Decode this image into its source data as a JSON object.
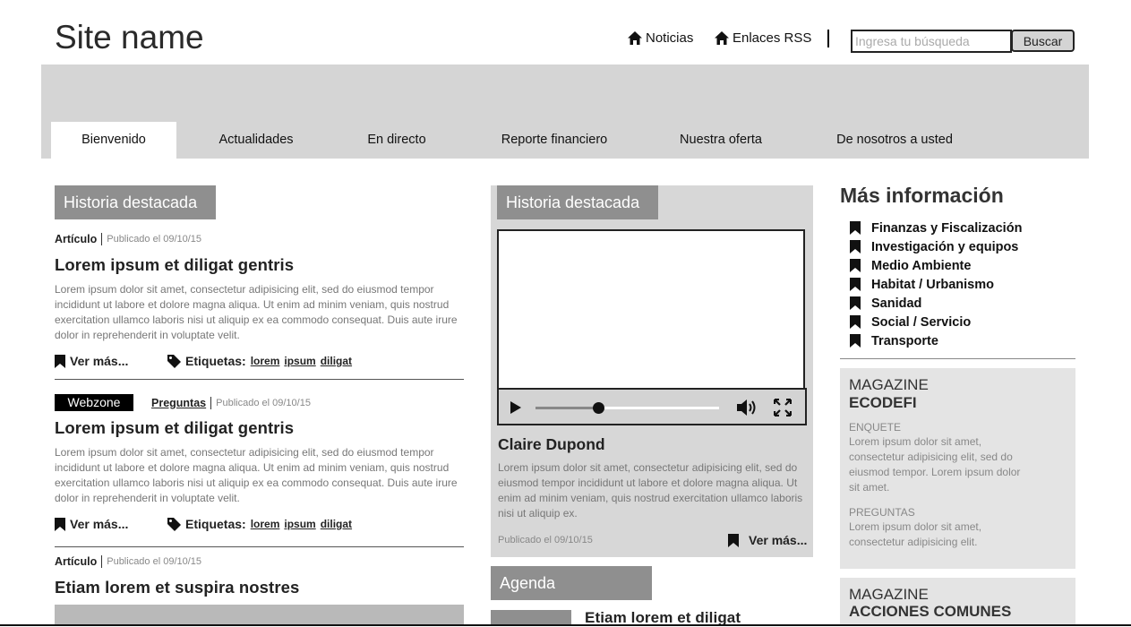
{
  "header": {
    "site_name": "Site name",
    "links": [
      {
        "label": "Noticias",
        "icon": "home-icon"
      },
      {
        "label": "Enlaces RSS",
        "icon": "home-icon"
      }
    ],
    "search": {
      "placeholder": "Ingresa tu búsqueda",
      "value": "",
      "button": "Buscar"
    }
  },
  "nav": {
    "tabs": [
      {
        "label": "Bienvenido",
        "active": true
      },
      {
        "label": "Actualidades"
      },
      {
        "label": "En directo"
      },
      {
        "label": "Reporte financiero"
      },
      {
        "label": "Nuestra oferta"
      },
      {
        "label": "De nosotros a usted"
      }
    ]
  },
  "left": {
    "section_title": "Historia destacada",
    "articles": [
      {
        "kind": "Artículo",
        "date": "Publicado el 09/10/15",
        "title": "Lorem ipsum et diligat gentris",
        "text": "Lorem ipsum dolor sit amet, consectetur adipisicing elit, sed do eiusmod tempor incididunt ut labore et dolore magna aliqua. Ut enim ad minim veniam, quis nostrud exercitation ullamco laboris nisi ut aliquip ex ea commodo consequat. Duis aute irure dolor in reprehenderit in voluptate velit.",
        "more": "Ver más...",
        "tags_label": "Etiquetas:",
        "tags": [
          "lorem",
          "ipsum",
          "diligat"
        ]
      },
      {
        "badge": "Webzone",
        "kind": "Preguntas",
        "date": "Publicado el 09/10/15",
        "title": "Lorem ipsum et diligat gentris",
        "text": "Lorem ipsum dolor sit amet, consectetur adipisicing elit, sed do eiusmod tempor incididunt ut labore et dolore magna aliqua. Ut enim ad minim veniam, quis nostrud exercitation ullamco laboris nisi ut aliquip ex ea commodo consequat. Duis aute irure dolor in reprehenderit in voluptate velit.",
        "more": "Ver más...",
        "tags_label": "Etiquetas:",
        "tags": [
          "lorem",
          "ipsum",
          "diligat"
        ]
      },
      {
        "kind": "Artículo",
        "date": "Publicado el 09/10/15",
        "title": "Etiam lorem et suspira nostres"
      }
    ]
  },
  "middle": {
    "section_title": "Historia destacada",
    "video": {
      "progress": 0.34
    },
    "title": "Claire Dupond",
    "text": "Lorem ipsum dolor sit amet, consectetur adipisicing elit, sed do eiusmod tempor incididunt ut labore et dolore magna aliqua. Ut enim ad minim veniam, quis nostrud exercitation ullamco laboris nisi ut aliquip ex.",
    "date": "Publicado el 09/10/15",
    "more": "Ver más...",
    "agenda_title": "Agenda",
    "agenda_item": "Etiam lorem et diligat"
  },
  "right": {
    "info_title": "Más información",
    "links": [
      "Finanzas y Fiscalización",
      "Investigación y equipos",
      "Medio Ambiente",
      "Habitat / Urbanismo",
      "Sanidad",
      "Social / Servicio",
      "Transporte"
    ],
    "magazines": [
      {
        "kicker": "MAGAZINE",
        "name": "ECODEFI",
        "sections": [
          {
            "label": "ENQUETE",
            "text": "Lorem ipsum dolor sit amet, consectetur adipisicing elit, sed do eiusmod tempor. Lorem ipsum dolor sit amet."
          },
          {
            "label": "PREGUNTAS",
            "text": "Lorem ipsum dolor sit amet, consectetur adipisicing elit."
          }
        ]
      },
      {
        "kicker": "MAGAZINE",
        "name": "ACCIONES COMUNES"
      }
    ]
  }
}
